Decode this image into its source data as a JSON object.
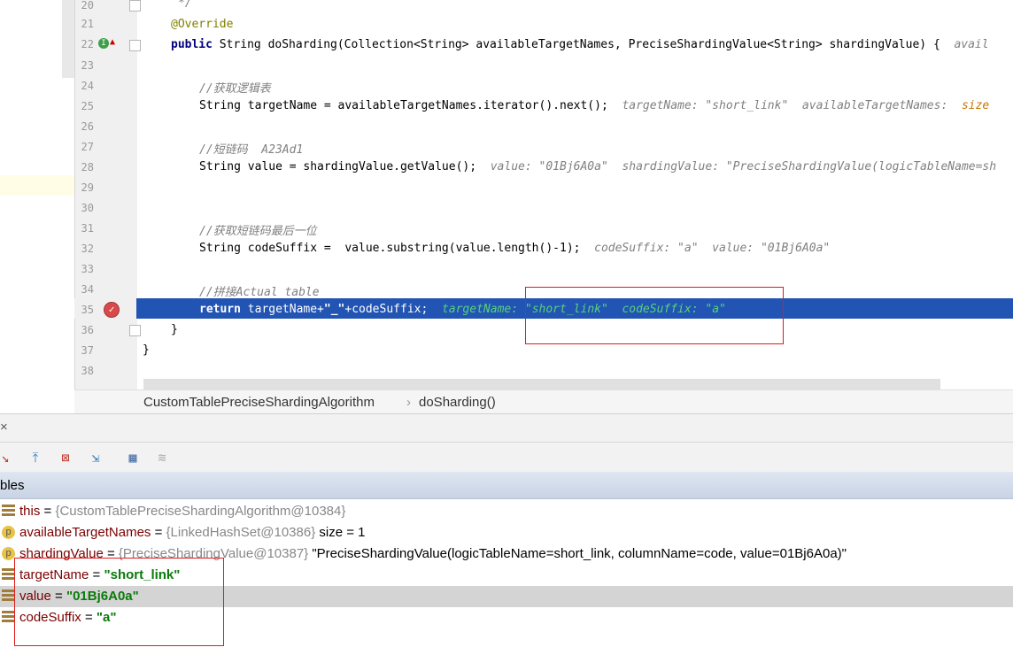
{
  "editor": {
    "lines": [
      {
        "num": "20"
      },
      {
        "num": "21",
        "text": "@Override"
      },
      {
        "num": "22",
        "kw": "public",
        "text": " String doSharding(Collection<String> availableTargetNames, PreciseShardingValue<String> shardingValue) {",
        "hint": "avail"
      },
      {
        "num": "23"
      },
      {
        "num": "24",
        "comment": "//获取逻辑表"
      },
      {
        "num": "25",
        "text": "String targetName = availableTargetNames.iterator().next();",
        "hint": "targetName: \"short_link\"  availableTargetNames:",
        "hint2": "size"
      },
      {
        "num": "26"
      },
      {
        "num": "27",
        "comment": "//短链码  A23Ad1"
      },
      {
        "num": "28",
        "text": "String value = shardingValue.getValue();",
        "hint": "value: \"01Bj6A0a\"  shardingValue: \"PreciseShardingValue(logicTableName=sh"
      },
      {
        "num": "29"
      },
      {
        "num": "30"
      },
      {
        "num": "31",
        "comment": "//获取短链码最后一位"
      },
      {
        "num": "32",
        "text": "String codeSuffix =  value.substring(value.length()-1);",
        "hint": "codeSuffix: \"a\"  value: \"01Bj6A0a\""
      },
      {
        "num": "33"
      },
      {
        "num": "34",
        "comment": "//拼接Actual table"
      },
      {
        "num": "35",
        "kw": "return",
        "text_a": " targetName+",
        "str": "\"_\"",
        "text_b": "+codeSuffix;",
        "hint": "targetName: \"short_link\"  codeSuffix: \"a\""
      },
      {
        "num": "36",
        "text": "}"
      },
      {
        "num": "37",
        "text": "}"
      },
      {
        "num": "38"
      }
    ],
    "line20_comment": "*/"
  },
  "breadcrumb": {
    "class_name": "CustomTablePreciseShardingAlgorithm",
    "separator": "›",
    "method": "doSharding()"
  },
  "debug": {
    "close_glyph": "×",
    "vars_header": "bles",
    "variables": [
      {
        "icon": "field-icon",
        "name": "this",
        "eq": " = ",
        "type": "{CustomTablePreciseShardingAlgorithm@10384}",
        "value": ""
      },
      {
        "icon": "param-icon",
        "name": "availableTargetNames",
        "eq": " = ",
        "type": "{LinkedHashSet@10386}",
        "value": "  size = 1"
      },
      {
        "icon": "param-icon",
        "name": "shardingValue",
        "eq": " = ",
        "type": "{PreciseShardingValue@10387}",
        "value": " \"PreciseShardingValue(logicTableName=short_link, columnName=code, value=01Bj6A0a)\""
      },
      {
        "icon": "field-icon",
        "name": "targetName",
        "eq": " = ",
        "type": "",
        "str": "\"short_link\""
      },
      {
        "icon": "field-icon",
        "name": "value",
        "eq": " = ",
        "type": "",
        "str": "\"01Bj6A0a\""
      },
      {
        "icon": "field-icon",
        "name": "codeSuffix",
        "eq": " = ",
        "type": "",
        "str": "\"a\""
      }
    ]
  },
  "colors": {
    "execution_line": "#2154b3",
    "annotation_box": "#e01b1b",
    "inline_hint_current": "#57d17a"
  }
}
